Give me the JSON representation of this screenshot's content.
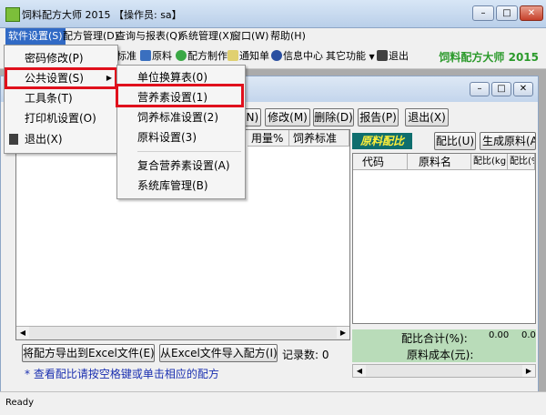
{
  "window": {
    "title": "饲料配方大师 2015 【操作员: sa】"
  },
  "menubar": {
    "items": [
      "软件设置(S)",
      "配方管理(D)",
      "查询与报表(Q)",
      "系统管理(X)",
      "窗口(W)",
      "帮助(H)"
    ]
  },
  "toolbar": {
    "items": [
      "标准",
      "原料",
      "配方制作",
      "通知单",
      "信息中心",
      "其它功能",
      "退出"
    ],
    "brand": "饲料配方大师  2015"
  },
  "inner": {
    "buttons": [
      "(N)",
      "修改(M)",
      "删除(D)",
      "报告(P)",
      "退出(X)"
    ],
    "left_columns": [
      "用量%",
      "饲养标准"
    ],
    "right_tab": "原料配比",
    "right_buttons": [
      "配比(U)",
      "生成原料(A"
    ],
    "right_columns": [
      "代码",
      "原料名",
      "配比(kg)",
      "配比(%"
    ],
    "summary": {
      "ratio_label": "配比合计(%):",
      "ratio_value1": "0.00",
      "ratio_value2": "0.0",
      "cost_label": "原料成本(元):"
    },
    "export_button": "将配方导出到Excel文件(E)",
    "import_button": "从Excel文件导入配方(I)",
    "record_count": "记录数: 0",
    "hint": "* 查看配比请按空格键或单击相应的配方"
  },
  "menu_software": {
    "items": [
      "密码修改(P)",
      "公共设置(S)",
      "工具条(T)",
      "打印机设置(O)",
      "退出(X)"
    ]
  },
  "submenu_public": {
    "items": [
      "单位换算表(0)",
      "营养素设置(1)",
      "饲养标准设置(2)",
      "原料设置(3)",
      "复合营养素设置(A)",
      "系统库管理(B)"
    ]
  },
  "status": {
    "text": "Ready"
  }
}
